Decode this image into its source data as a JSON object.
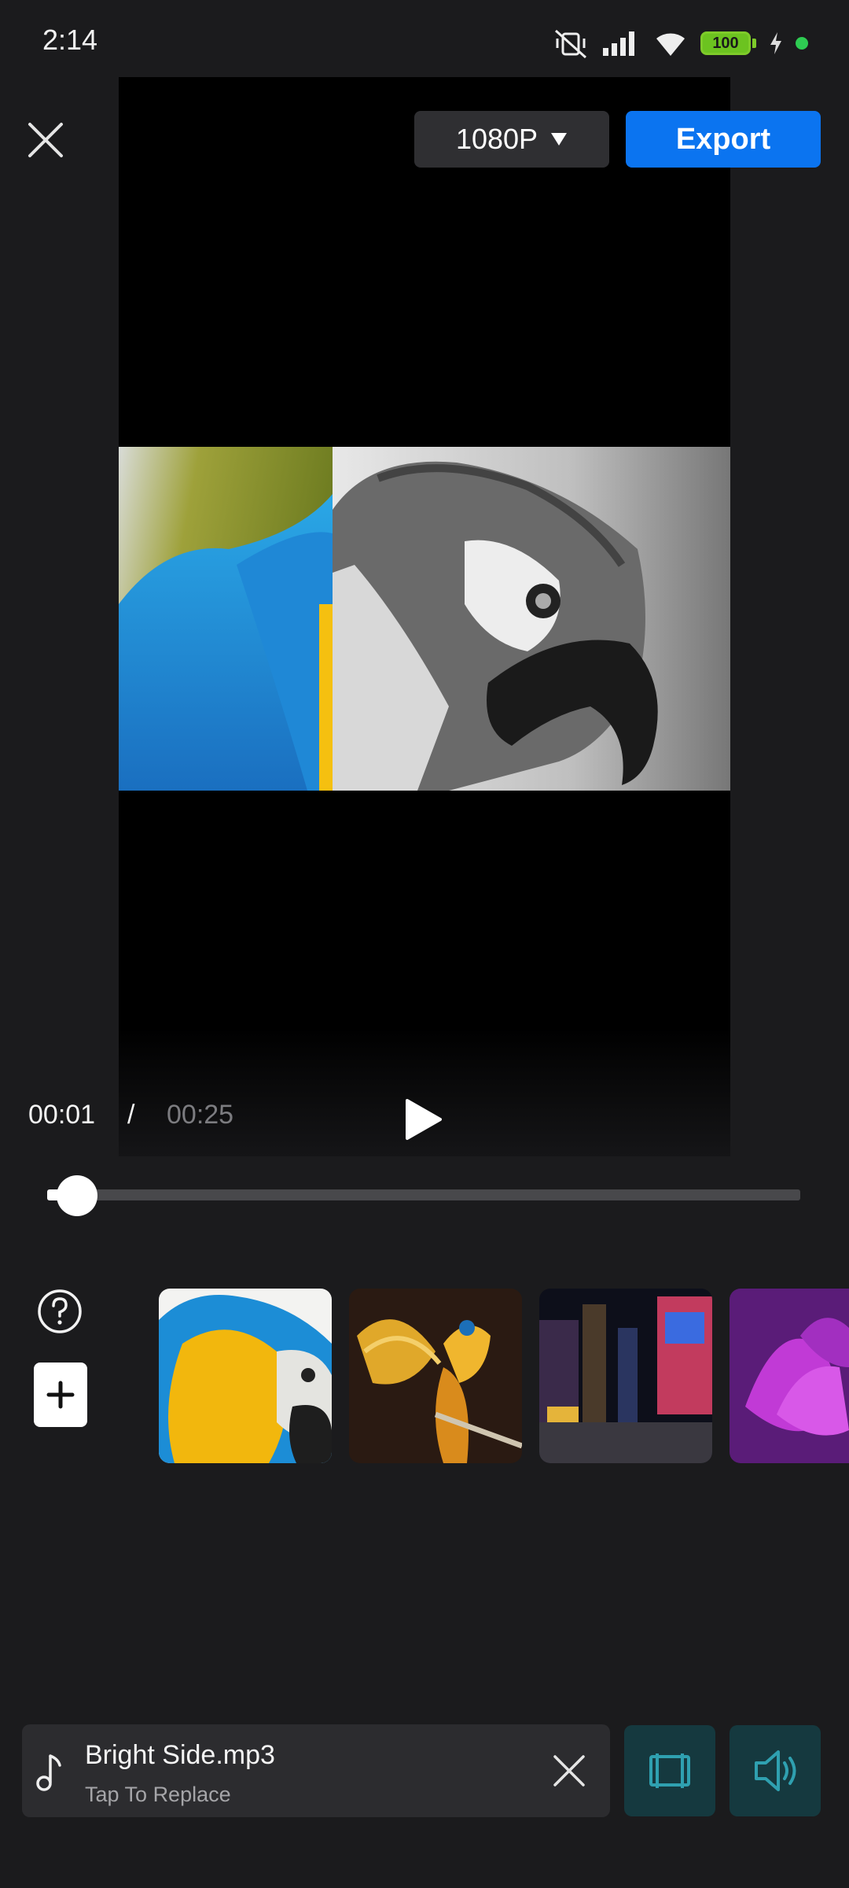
{
  "status_bar": {
    "time": "2:14",
    "battery": "100",
    "icons": [
      "mute-vibrate-icon",
      "signal-icon",
      "wifi-icon",
      "battery-icon",
      "charging-icon",
      "active-dot-icon"
    ]
  },
  "header": {
    "resolution": "1080P",
    "export_label": "Export"
  },
  "player": {
    "current_time": "00:01",
    "separator": "/",
    "total_time": "00:25",
    "progress": 0.04
  },
  "thumbnails": [
    {
      "subject": "macaw-closeup"
    },
    {
      "subject": "parrot-spread-wings"
    },
    {
      "subject": "city-night-street"
    },
    {
      "subject": "purple-flower"
    }
  ],
  "music": {
    "name": "Bright Side.mp3",
    "subtitle": "Tap To Replace"
  },
  "colors": {
    "background": "#1b1b1d",
    "accent": "#0b74f0",
    "tool_button": "#15393f",
    "tool_icon": "#2fa0b0"
  }
}
